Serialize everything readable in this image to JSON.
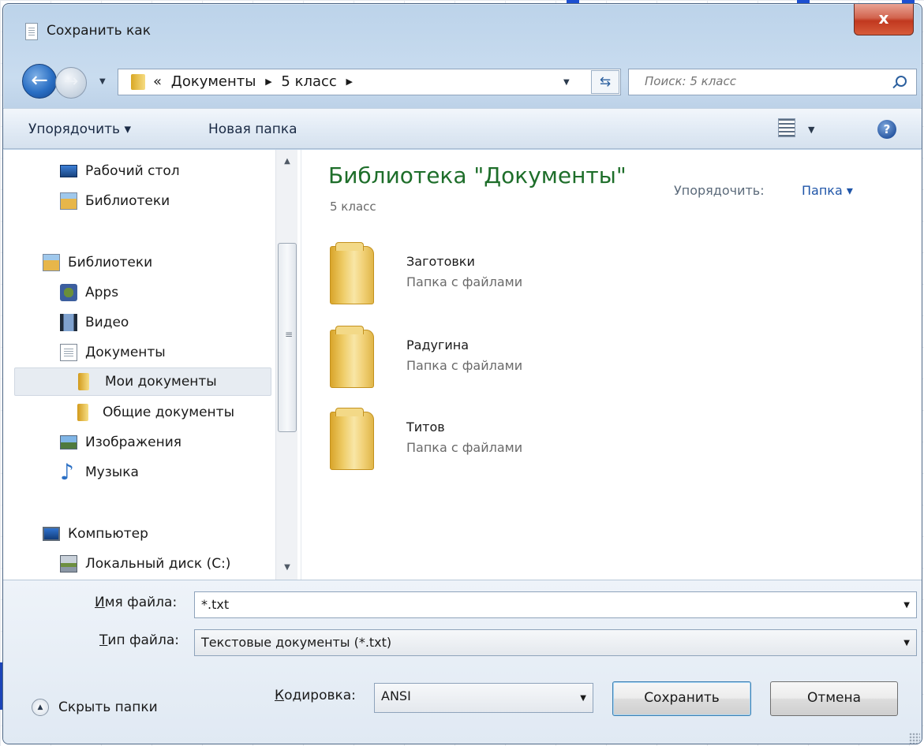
{
  "window": {
    "title": "Сохранить как",
    "close_label": "x"
  },
  "address_bar": {
    "overflow": "«",
    "crumbs": [
      "Документы",
      "5 класс"
    ],
    "search_placeholder": "Поиск: 5 класс"
  },
  "toolbar": {
    "organize_label": "Упорядочить ▾",
    "new_folder_label": "Новая папка",
    "help_label": "?"
  },
  "nav_pane": {
    "items": [
      {
        "label": "Рабочий стол",
        "icon": "desktop-icon"
      },
      {
        "label": "Библиотеки",
        "icon": "libraries-icon"
      },
      {
        "label": "Библиотеки",
        "icon": "libraries-icon"
      },
      {
        "label": "Apps",
        "icon": "apps-icon"
      },
      {
        "label": "Видео",
        "icon": "video-icon"
      },
      {
        "label": "Документы",
        "icon": "documents-icon"
      },
      {
        "label": "Мои документы",
        "icon": "folder-icon",
        "selected": true
      },
      {
        "label": "Общие документы",
        "icon": "folder-icon"
      },
      {
        "label": "Изображения",
        "icon": "images-icon"
      },
      {
        "label": "Музыка",
        "icon": "music-icon"
      },
      {
        "label": "Компьютер",
        "icon": "computer-icon"
      },
      {
        "label": "Локальный диск (C:)",
        "icon": "disk-icon"
      }
    ]
  },
  "main": {
    "library_title": "Библиотека \"Документы\"",
    "subtitle": "5 класс",
    "arrange_by_label": "Упорядочить:",
    "arrange_by_value": "Папка ▾",
    "files": [
      {
        "name": "Заготовки",
        "type": "Папка с файлами"
      },
      {
        "name": "Радугина",
        "type": "Папка с файлами"
      },
      {
        "name": "Титов",
        "type": "Папка с файлами"
      }
    ]
  },
  "form": {
    "filename_label_hotkey": "И",
    "filename_label_rest": "мя файла:",
    "filename_value": "*.txt",
    "filetype_label_hotkey": "Т",
    "filetype_label_rest": "ип файла:",
    "filetype_value": "Текстовые документы (*.txt)",
    "encoding_label_hotkey": "К",
    "encoding_label_rest": "одировка:",
    "encoding_value": "ANSI",
    "hide_folders_label": "Скрыть папки",
    "save_label": "Сохранить",
    "cancel_label": "Отмена"
  },
  "colors": {
    "library_title": "#1e6e2a",
    "close_button": "#c1381f",
    "link": "#1f55a8"
  }
}
